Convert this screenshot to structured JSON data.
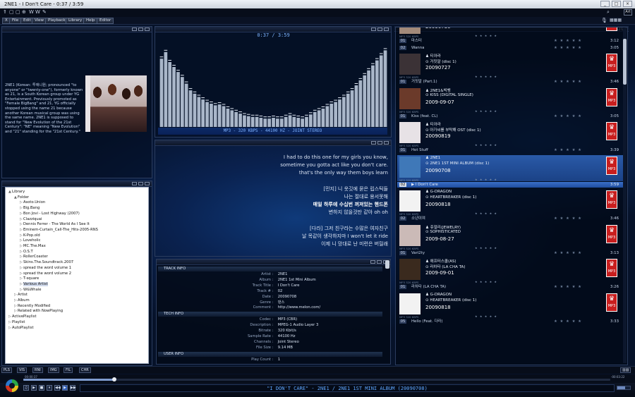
{
  "window": {
    "title": "2NE1 - I Don't Care - 0:37 / 3:59",
    "buttons": [
      "_",
      "□",
      "×"
    ]
  },
  "iconbar": {
    "left_icons": [
      "⇑",
      "▢",
      "▢",
      "⊕",
      "W",
      "W",
      "✎"
    ],
    "art_toggle": "Art"
  },
  "menu": [
    "X",
    "File",
    "Edit",
    "View",
    "Playback",
    "Library",
    "Help",
    "Editor"
  ],
  "artist_info": {
    "bio": "2NE1 (Korean: 투애니원; pronounced \"to anyone\" or \"twenty-one\"), formerly known as 21, is a South Korean group under YG Entertainment. Previously promoted as \"Female BigBang\" and 21, YG officially stopped using the name 21 because another Korean musical group was using the same name. 2NE1 is supposed to stand for \"New Evolution of the 21st Century\": \"NE\" meaning \"New Evolution\" and \"21\" standing for the \"21st Century.\""
  },
  "library": {
    "items": [
      {
        "label": "Library",
        "ex": "▲",
        "lvl": 0
      },
      {
        "label": "Folder",
        "ex": "▲",
        "lvl": 1
      },
      {
        "label": "Asoto.Union",
        "ex": "▷",
        "lvl": 2
      },
      {
        "label": "Big.Bang",
        "ex": "▷",
        "lvl": 2
      },
      {
        "label": "Bon Jovi - Lost Highway (2007)",
        "ex": "▷",
        "lvl": 2
      },
      {
        "label": "Clazziquai",
        "ex": "▷",
        "lvl": 2
      },
      {
        "label": "Dennis Ferrer - The World As I See It",
        "ex": "▷",
        "lvl": 2
      },
      {
        "label": "Eminem-Curtain_Call-The_Hits-2005-RNS",
        "ex": "▷",
        "lvl": 2
      },
      {
        "label": "K-Pop.old",
        "ex": "▷",
        "lvl": 2
      },
      {
        "label": "Loveholic",
        "ex": "▷",
        "lvl": 2
      },
      {
        "label": "MC.The.Max",
        "ex": "▷",
        "lvl": 2
      },
      {
        "label": "O.S.T",
        "ex": "▷",
        "lvl": 2
      },
      {
        "label": "RollerCoaster",
        "ex": "▷",
        "lvl": 2
      },
      {
        "label": "Skins.The.Soundtrack.2007",
        "ex": "▷",
        "lvl": 2
      },
      {
        "label": "spread the word volume 1",
        "ex": "▷",
        "lvl": 2
      },
      {
        "label": "spread the word volume 2",
        "ex": "▷",
        "lvl": 2
      },
      {
        "label": "T-square",
        "ex": "▷",
        "lvl": 2
      },
      {
        "label": "Various Artist",
        "ex": "▷",
        "lvl": 2,
        "sel": true
      },
      {
        "label": "W&Whale",
        "ex": "▷",
        "lvl": 2
      },
      {
        "label": "Artist",
        "ex": "▷",
        "lvl": 1
      },
      {
        "label": "Album",
        "ex": "▷",
        "lvl": 1
      },
      {
        "label": "Recently Modified",
        "ex": "▷",
        "lvl": 1
      },
      {
        "label": "Related with NowPlaying",
        "ex": "▷",
        "lvl": 1
      },
      {
        "label": "ActivePlaylist",
        "ex": "▷",
        "lvl": 0
      },
      {
        "label": "Playlist",
        "ex": "▷",
        "lvl": 0
      },
      {
        "label": "AutoPlaylist",
        "ex": "▷",
        "lvl": 0
      }
    ]
  },
  "visualizer": {
    "time": "0:37 / 3:59",
    "format": "MP3 - 320 KBPS - 44100 HZ - JOINT STEREO",
    "levels": [
      0.82,
      0.9,
      0.78,
      0.72,
      0.66,
      0.6,
      0.52,
      0.44,
      0.4,
      0.36,
      0.33,
      0.3,
      0.28,
      0.26,
      0.27,
      0.25,
      0.22,
      0.2,
      0.18,
      0.16,
      0.14,
      0.13,
      0.12,
      0.12,
      0.11,
      0.1,
      0.1,
      0.11,
      0.1,
      0.1,
      0.12,
      0.14,
      0.12,
      0.11,
      0.1,
      0.12,
      0.15,
      0.18,
      0.2,
      0.22,
      0.25,
      0.28,
      0.3,
      0.33,
      0.36,
      0.4,
      0.44,
      0.5,
      0.56,
      0.62,
      0.68,
      0.74,
      0.8,
      0.86,
      0.92
    ]
  },
  "lyrics": {
    "lines": [
      "I had to do this one for my girls you know,",
      "sometime you gotta act like you don't care.",
      "that's the only way them boys learn",
      "",
      "[민지] 니 옷깃에 묻은 립스틱들",
      "나는 절대로 용서못해",
      "매일 하루에 수십번 꺼져있는 핸드폰",
      "변하지 않을것만 같아 oh oh",
      "",
      "[다라] 그저 친구라는 수많은 여자친구",
      "날 목같이 생각하지마 I won't let it ride",
      "이제 니 망대로 난 미련은 버릴래"
    ],
    "current": 6
  },
  "track_info": {
    "sections": [
      {
        "title": "TRACK INFO",
        "rows": [
          [
            "Artist",
            "2NE1"
          ],
          [
            "Album",
            "2NE1 1st Mini Album"
          ],
          [
            "Track Title",
            "I Don't Care"
          ],
          [
            "Track #",
            "02"
          ],
          [
            "Date",
            "20090708"
          ],
          [
            "Genre",
            "댄스"
          ],
          [
            "Comment",
            "http://www.melon.com/"
          ]
        ]
      },
      {
        "title": "TECH INFO",
        "rows": [
          [
            "Codec",
            "MP3 (CBR)"
          ],
          [
            "Description",
            "MPEG-1 Audio Layer 3"
          ],
          [
            "Bitrate",
            "320 Kbit/s"
          ],
          [
            "Sample Rate",
            "44100 Hz"
          ],
          [
            "Channels",
            "Joint Stereo"
          ],
          [
            "File Size",
            "9.14 MB"
          ]
        ]
      },
      {
        "title": "USER INFO",
        "rows": [
          [
            "Play Count",
            "1"
          ]
        ]
      }
    ]
  },
  "playlist": {
    "entries": [
      {
        "kind": "card",
        "artist": "",
        "album": "",
        "date": "20090730",
        "cover": "#a38a7a",
        "partial_top": true
      },
      {
        "kind": "track",
        "n": "01",
        "title": "마스터",
        "dur": "3:12"
      },
      {
        "kind": "track",
        "n": "02",
        "title": "Wanna",
        "dur": "3:05"
      },
      {
        "kind": "card",
        "artist": "티아라",
        "album": "거짓말 (disc 1)",
        "date": "20090727",
        "cover": "#3b3236"
      },
      {
        "kind": "track",
        "n": "01",
        "title": "거짓말 (Part.1)",
        "dur": "3:46"
      },
      {
        "kind": "card",
        "artist": "2NE1&빅뱅",
        "album": "KISS (DIGITAL SINGLE)",
        "date": "2009-09-07",
        "cover": "#6b3a2a"
      },
      {
        "kind": "track",
        "n": "01",
        "title": "Kiss (feat. CL)",
        "dur": "3:05"
      },
      {
        "kind": "card",
        "artist": "티아라",
        "album": "아가씨를 부탁해 OST (disc 1)",
        "date": "20090819",
        "cover": "#e7e2e6"
      },
      {
        "kind": "track",
        "n": "01",
        "title": "Hot Stuff",
        "dur": "3:39"
      },
      {
        "kind": "card",
        "artist": "2NE1",
        "album": "2NE1 1ST MINI ALBUM (disc 1)",
        "date": "20090708",
        "cover": "#3f78b8",
        "selected": true
      },
      {
        "kind": "play",
        "n": "02",
        "title": "I Don't Care",
        "dur": "3:59"
      },
      {
        "kind": "card",
        "artist": "G-DRAGON",
        "album": "HEARTBREAKER (disc 1)",
        "date": "20090818",
        "cover": "#f2f2f2"
      },
      {
        "kind": "track",
        "n": "02",
        "title": "소년이여",
        "dur": "3:46"
      },
      {
        "kind": "card",
        "artist": "쥬얼리(JEWELRY)",
        "album": "SOPHISTICATED",
        "date": "2009-08-27",
        "cover": "#cbbab7"
      },
      {
        "kind": "track",
        "n": "01",
        "title": "Vari2ty",
        "dur": "3:13"
      },
      {
        "kind": "card",
        "artist": "애프터스쿨(AS)",
        "album": "라차타 (LA CHA TA)",
        "date": "2009-09-01",
        "cover": "#3a2a1e"
      },
      {
        "kind": "track",
        "n": "01",
        "title": "라차타 (LA CHA TA)",
        "dur": "3:26"
      },
      {
        "kind": "card",
        "artist": "G-DRAGON",
        "album": "HEARTBREAKER (disc 1)",
        "date": "20090818",
        "cover": "#f2f2f2"
      },
      {
        "kind": "track",
        "n": "05",
        "title": "Hello (Feat. 다라)",
        "dur": "3:33"
      }
    ],
    "meta_text": "MP3   320 KBPS",
    "stars": "★ ★ ★ ★ ★",
    "mp3_label": "MP3",
    "logo_glyph": "♛"
  },
  "status_buttons": [
    "PLS",
    "VIS",
    "RNI",
    "IMG",
    "FIL",
    "CHR"
  ],
  "seek": {
    "elapsed": "00:00:37",
    "remain": "-00:03:22",
    "progress": 0.155
  },
  "transport": {
    "buttons": [
      "♫",
      "▶",
      "■",
      "⏸",
      "◀◀",
      "▶",
      "▶▶"
    ],
    "now_playing": "\"I DON'T CARE\" - 2NE1 / 2NE1 1ST MINI ALBUM (20090708)",
    "volume": 0.6
  },
  "colors": {
    "accent": "#5fa7ff",
    "badge": "#c81e1e",
    "bg": "#061229"
  }
}
